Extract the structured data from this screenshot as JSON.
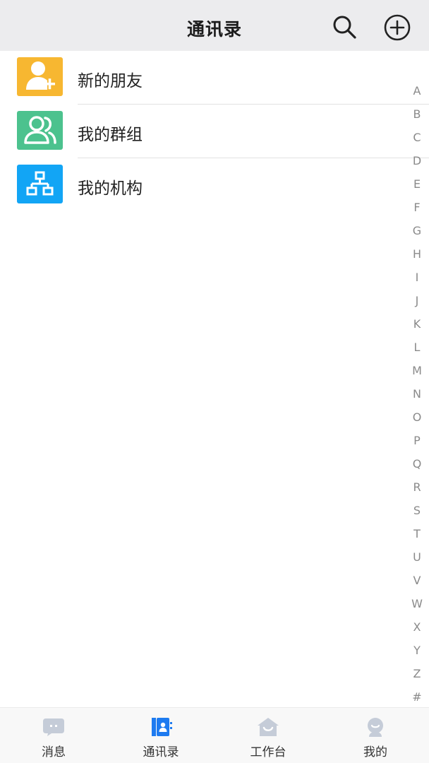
{
  "header": {
    "title": "通讯录",
    "search_icon": "search-icon",
    "add_icon": "plus-circle-icon"
  },
  "list": {
    "items": [
      {
        "label": "新的朋友",
        "icon": "add-friend-icon",
        "color": "#F7B731"
      },
      {
        "label": "我的群组",
        "icon": "group-icon",
        "color": "#4CC28E"
      },
      {
        "label": "我的机构",
        "icon": "organization-icon",
        "color": "#12A5F5"
      }
    ]
  },
  "index_bar": {
    "letters": [
      "A",
      "B",
      "C",
      "D",
      "E",
      "F",
      "G",
      "H",
      "I",
      "J",
      "K",
      "L",
      "M",
      "N",
      "O",
      "P",
      "Q",
      "R",
      "S",
      "T",
      "U",
      "V",
      "W",
      "X",
      "Y",
      "Z",
      "#"
    ]
  },
  "tabbar": {
    "active_color": "#1E7BF0",
    "inactive_color": "#C5CCD8",
    "tabs": [
      {
        "label": "消息",
        "icon": "message-icon",
        "active": false
      },
      {
        "label": "通讯录",
        "icon": "contacts-icon",
        "active": true
      },
      {
        "label": "工作台",
        "icon": "workbench-icon",
        "active": false
      },
      {
        "label": "我的",
        "icon": "profile-icon",
        "active": false
      }
    ]
  }
}
